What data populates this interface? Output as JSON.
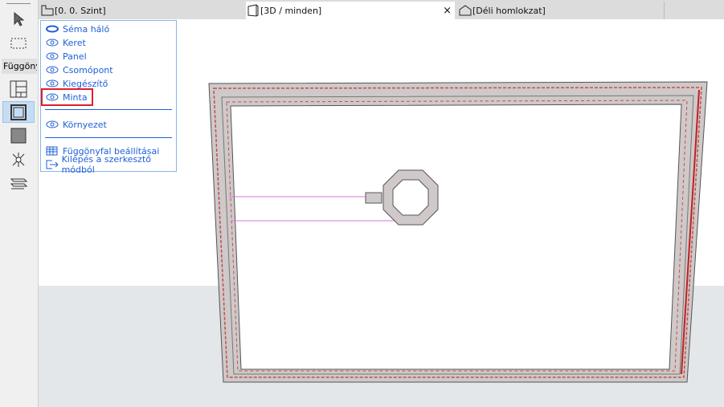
{
  "toolbar": {
    "label": "Függöny"
  },
  "tabs": [
    {
      "label": "[0. 0. Szint]"
    },
    {
      "label": "[3D / minden]",
      "close": "×"
    },
    {
      "label": "[Déli homlokzat]"
    }
  ],
  "menu": {
    "items": [
      {
        "label": "Séma háló",
        "icon": "eye-closed-icon"
      },
      {
        "label": "Keret",
        "icon": "eye-icon"
      },
      {
        "label": "Panel",
        "icon": "eye-icon"
      },
      {
        "label": "Csomópont",
        "icon": "eye-icon"
      },
      {
        "label": "Kiegészítő",
        "icon": "eye-icon"
      },
      {
        "label": "Minta",
        "icon": "eye-icon",
        "highlighted": true
      },
      {
        "label": "Környezet",
        "icon": "eye-icon"
      },
      {
        "label": "Függönyfal beállításai",
        "icon": "table-icon"
      },
      {
        "label": "Kilépés a szerkesztő módból",
        "icon": "exit-icon"
      }
    ]
  },
  "colors": {
    "menu_text": "#1f5fd8",
    "highlight": "#e0202a",
    "ground": "#e3e7ea"
  }
}
